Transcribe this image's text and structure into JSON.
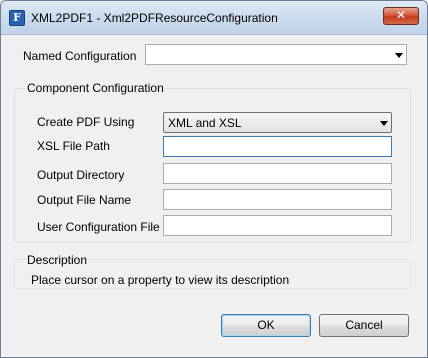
{
  "window": {
    "title": "XML2PDF1 - Xml2PDFResourceConfiguration",
    "icon_glyph": "F",
    "close_glyph": "✕"
  },
  "named_configuration": {
    "label": "Named Configuration",
    "value": ""
  },
  "component_configuration": {
    "group_title": "Component Configuration",
    "create_pdf_using": {
      "label": "Create PDF Using",
      "value": "XML and XSL"
    },
    "xsl_file_path": {
      "label": "XSL File Path",
      "value": ""
    },
    "output_directory": {
      "label": "Output Directory",
      "value": ""
    },
    "output_file_name": {
      "label": "Output File Name",
      "value": ""
    },
    "user_configuration_file": {
      "label": "User Configuration File",
      "value": ""
    }
  },
  "description": {
    "group_title": "Description",
    "text": "Place cursor on a property to view its description"
  },
  "buttons": {
    "ok": "OK",
    "cancel": "Cancel"
  },
  "icons": {
    "app": "app-icon",
    "close": "close-icon",
    "dropdown": "chevron-down-icon"
  },
  "colors": {
    "titlebar": "#cddcee",
    "close_button": "#c23c1d",
    "focus_border": "#3d7bad"
  }
}
